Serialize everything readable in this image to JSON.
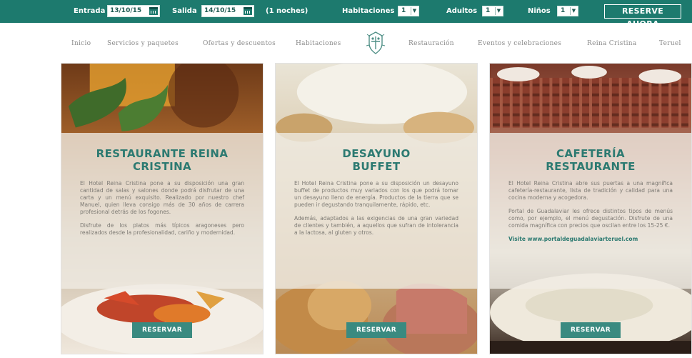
{
  "booking": {
    "checkin_label": "Entrada",
    "checkin_value": "13/10/15",
    "checkout_label": "Salida",
    "checkout_value": "14/10/15",
    "nights": "(1 noches)",
    "rooms_label": "Habitaciones",
    "rooms_value": "1",
    "adults_label": "Adultos",
    "adults_value": "1",
    "children_label": "Niños",
    "children_value": "1",
    "reserve_label": "RESERVE AHORA"
  },
  "nav": {
    "items": [
      "Inicio",
      "Servicios y paquetes",
      "Ofertas y descuentos",
      "Habitaciones",
      "Restauración",
      "Eventos y celebraciones",
      "Reina Cristina",
      "Teruel"
    ],
    "logo_icon": "hotel-crest-icon"
  },
  "cards": [
    {
      "title_line1": "RESTAURANTE REINA",
      "title_line2": "CRISTINA",
      "para1": "El Hotel Reina Cristina pone a su disposición una gran cantidad de salas y salones donde podrá disfrutar de una carta y un menú exquisito. Realizado por nuestro chef Manuel, quien lleva consigo más de 30 años de carrera profesional detrás de los fogones.",
      "para2": "Disfrute de los platos más típicos aragoneses pero realizados desde la profesionalidad, cariño y modernidad.",
      "button": "RESERVAR"
    },
    {
      "title_line1": "DESAYUNO",
      "title_line2": "BUFFET",
      "para1": "El Hotel Reina Cristina pone a su disposición un desayuno buffet de productos muy variados con los que podrá tomar un desayuno lleno de energía. Productos de la tierra que se pueden ir degustando tranquilamente, rápido, etc.",
      "para2": "Además, adaptados a las exigencias de una gran variedad de clientes y también, a aquellos que sufran de intolerancia a la lactosa, al gluten y otros.",
      "button": "RESERVAR"
    },
    {
      "title_line1": "CAFETERÍA",
      "title_line2": "RESTAURANTE",
      "para1": "El Hotel Reina Cristina abre sus puertas a una magnífica cafetería-restaurante, lista de tradición y calidad para una cocina moderna y acogedora.",
      "para2": "Portal de Guadalaviar les ofrece distintos tipos de menús como, por ejemplo, el menú degustación. Disfrute de una comida magnífica con precios que oscilan entre los 15-25 €.",
      "link": "Visite www.portaldeguadalaviarteruel.com",
      "button": "RESERVAR"
    }
  ],
  "colors": {
    "brand_teal": "#1d7a6e",
    "title_teal": "#2c7a71",
    "button_teal": "#3a8a80"
  }
}
